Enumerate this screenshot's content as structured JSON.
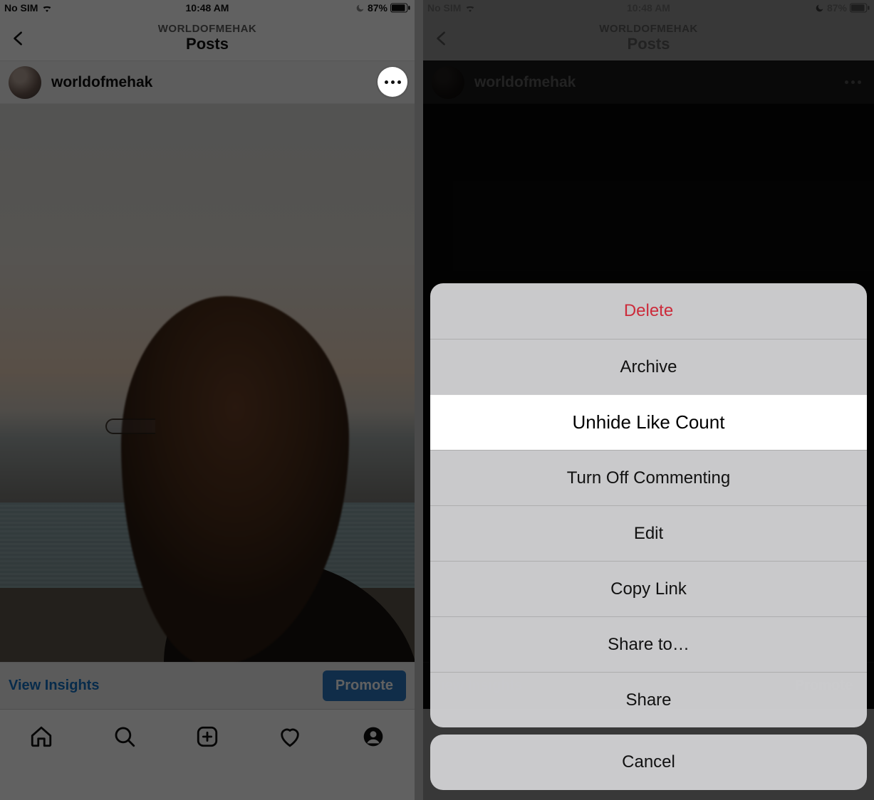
{
  "status": {
    "carrier": "No SIM",
    "time": "10:48 AM",
    "battery_pct": "87%"
  },
  "header": {
    "subtitle": "WORLDOFMEHAK",
    "title": "Posts"
  },
  "post": {
    "author": "worldofmehak",
    "insights_label": "View Insights",
    "promote_label": "Promote"
  },
  "tabs": {
    "home": "home-icon",
    "search": "search-icon",
    "add": "add-post-icon",
    "activity": "heart-icon",
    "profile": "profile-icon"
  },
  "sheet": {
    "items": [
      {
        "label": "Delete",
        "destructive": true
      },
      {
        "label": "Archive"
      },
      {
        "label": "Unhide Like Count",
        "highlight": true
      },
      {
        "label": "Turn Off Commenting"
      },
      {
        "label": "Edit"
      },
      {
        "label": "Copy Link"
      },
      {
        "label": "Share to…"
      },
      {
        "label": "Share"
      }
    ],
    "cancel": "Cancel"
  }
}
